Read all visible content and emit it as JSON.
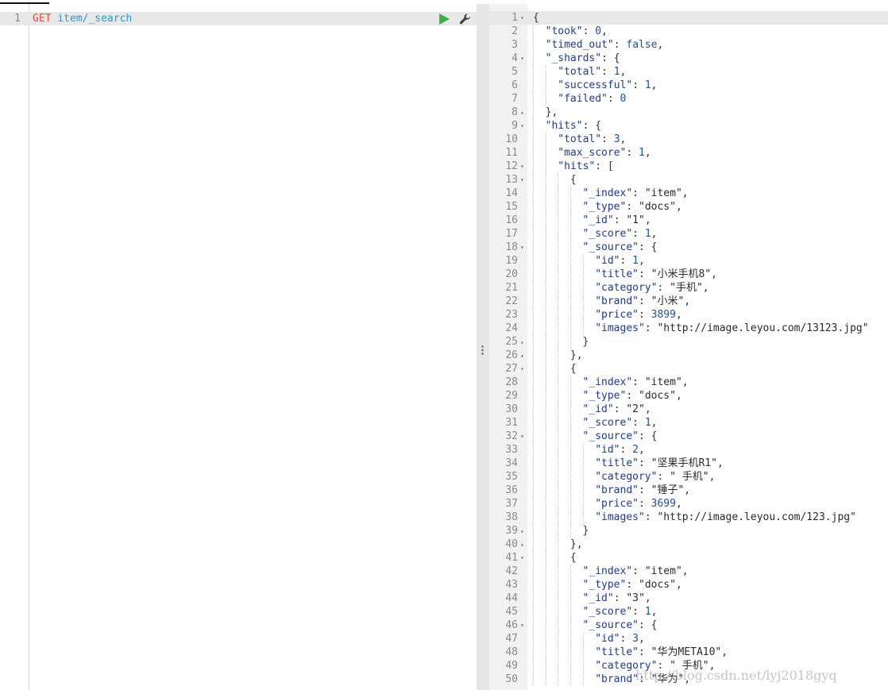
{
  "request": {
    "line_number": "1",
    "method": "GET",
    "path": "item/_search",
    "run_icon": "play-icon",
    "settings_icon": "wrench-icon"
  },
  "response": {
    "lines": [
      {
        "n": "1",
        "fold": "▾",
        "indent": 0,
        "t": [
          [
            "p",
            "{"
          ]
        ]
      },
      {
        "n": "2",
        "indent": 1,
        "t": [
          [
            "k",
            "\"took\""
          ],
          [
            "p",
            ": "
          ],
          [
            "n",
            "0"
          ],
          [
            "p",
            ","
          ]
        ]
      },
      {
        "n": "3",
        "indent": 1,
        "t": [
          [
            "k",
            "\"timed_out\""
          ],
          [
            "p",
            ": "
          ],
          [
            "b",
            "false"
          ],
          [
            "p",
            ","
          ]
        ]
      },
      {
        "n": "4",
        "fold": "▾",
        "indent": 1,
        "t": [
          [
            "k",
            "\"_shards\""
          ],
          [
            "p",
            ": {"
          ]
        ]
      },
      {
        "n": "5",
        "indent": 2,
        "t": [
          [
            "k",
            "\"total\""
          ],
          [
            "p",
            ": "
          ],
          [
            "n",
            "1"
          ],
          [
            "p",
            ","
          ]
        ]
      },
      {
        "n": "6",
        "indent": 2,
        "t": [
          [
            "k",
            "\"successful\""
          ],
          [
            "p",
            ": "
          ],
          [
            "n",
            "1"
          ],
          [
            "p",
            ","
          ]
        ]
      },
      {
        "n": "7",
        "indent": 2,
        "t": [
          [
            "k",
            "\"failed\""
          ],
          [
            "p",
            ": "
          ],
          [
            "n",
            "0"
          ]
        ]
      },
      {
        "n": "8",
        "fold": "▴",
        "indent": 1,
        "t": [
          [
            "p",
            "},"
          ]
        ]
      },
      {
        "n": "9",
        "fold": "▾",
        "indent": 1,
        "t": [
          [
            "k",
            "\"hits\""
          ],
          [
            "p",
            ": {"
          ]
        ]
      },
      {
        "n": "10",
        "indent": 2,
        "t": [
          [
            "k",
            "\"total\""
          ],
          [
            "p",
            ": "
          ],
          [
            "n",
            "3"
          ],
          [
            "p",
            ","
          ]
        ]
      },
      {
        "n": "11",
        "indent": 2,
        "t": [
          [
            "k",
            "\"max_score\""
          ],
          [
            "p",
            ": "
          ],
          [
            "n",
            "1"
          ],
          [
            "p",
            ","
          ]
        ]
      },
      {
        "n": "12",
        "fold": "▾",
        "indent": 2,
        "t": [
          [
            "k",
            "\"hits\""
          ],
          [
            "p",
            ": ["
          ]
        ]
      },
      {
        "n": "13",
        "fold": "▾",
        "indent": 3,
        "t": [
          [
            "p",
            "{"
          ]
        ]
      },
      {
        "n": "14",
        "indent": 4,
        "t": [
          [
            "k",
            "\"_index\""
          ],
          [
            "p",
            ": "
          ],
          [
            "s",
            "\"item\""
          ],
          [
            "p",
            ","
          ]
        ]
      },
      {
        "n": "15",
        "indent": 4,
        "t": [
          [
            "k",
            "\"_type\""
          ],
          [
            "p",
            ": "
          ],
          [
            "s",
            "\"docs\""
          ],
          [
            "p",
            ","
          ]
        ]
      },
      {
        "n": "16",
        "indent": 4,
        "t": [
          [
            "k",
            "\"_id\""
          ],
          [
            "p",
            ": "
          ],
          [
            "s",
            "\"1\""
          ],
          [
            "p",
            ","
          ]
        ]
      },
      {
        "n": "17",
        "indent": 4,
        "t": [
          [
            "k",
            "\"_score\""
          ],
          [
            "p",
            ": "
          ],
          [
            "n",
            "1"
          ],
          [
            "p",
            ","
          ]
        ]
      },
      {
        "n": "18",
        "fold": "▾",
        "indent": 4,
        "t": [
          [
            "k",
            "\"_source\""
          ],
          [
            "p",
            ": {"
          ]
        ]
      },
      {
        "n": "19",
        "indent": 5,
        "t": [
          [
            "k",
            "\"id\""
          ],
          [
            "p",
            ": "
          ],
          [
            "n",
            "1"
          ],
          [
            "p",
            ","
          ]
        ]
      },
      {
        "n": "20",
        "indent": 5,
        "t": [
          [
            "k",
            "\"title\""
          ],
          [
            "p",
            ": "
          ],
          [
            "s",
            "\"小米手机8\""
          ],
          [
            "p",
            ","
          ]
        ]
      },
      {
        "n": "21",
        "indent": 5,
        "t": [
          [
            "k",
            "\"category\""
          ],
          [
            "p",
            ": "
          ],
          [
            "s",
            "\"手机\""
          ],
          [
            "p",
            ","
          ]
        ]
      },
      {
        "n": "22",
        "indent": 5,
        "t": [
          [
            "k",
            "\"brand\""
          ],
          [
            "p",
            ": "
          ],
          [
            "s",
            "\"小米\""
          ],
          [
            "p",
            ","
          ]
        ]
      },
      {
        "n": "23",
        "indent": 5,
        "t": [
          [
            "k",
            "\"price\""
          ],
          [
            "p",
            ": "
          ],
          [
            "n",
            "3899"
          ],
          [
            "p",
            ","
          ]
        ]
      },
      {
        "n": "24",
        "indent": 5,
        "t": [
          [
            "k",
            "\"images\""
          ],
          [
            "p",
            ": "
          ],
          [
            "s",
            "\"http://image.leyou.com/13123.jpg\""
          ]
        ]
      },
      {
        "n": "25",
        "fold": "▴",
        "indent": 4,
        "t": [
          [
            "p",
            "}"
          ]
        ]
      },
      {
        "n": "26",
        "fold": "▴",
        "indent": 3,
        "t": [
          [
            "p",
            "},"
          ]
        ]
      },
      {
        "n": "27",
        "fold": "▾",
        "indent": 3,
        "t": [
          [
            "p",
            "{"
          ]
        ]
      },
      {
        "n": "28",
        "indent": 4,
        "t": [
          [
            "k",
            "\"_index\""
          ],
          [
            "p",
            ": "
          ],
          [
            "s",
            "\"item\""
          ],
          [
            "p",
            ","
          ]
        ]
      },
      {
        "n": "29",
        "indent": 4,
        "t": [
          [
            "k",
            "\"_type\""
          ],
          [
            "p",
            ": "
          ],
          [
            "s",
            "\"docs\""
          ],
          [
            "p",
            ","
          ]
        ]
      },
      {
        "n": "30",
        "indent": 4,
        "t": [
          [
            "k",
            "\"_id\""
          ],
          [
            "p",
            ": "
          ],
          [
            "s",
            "\"2\""
          ],
          [
            "p",
            ","
          ]
        ]
      },
      {
        "n": "31",
        "indent": 4,
        "t": [
          [
            "k",
            "\"_score\""
          ],
          [
            "p",
            ": "
          ],
          [
            "n",
            "1"
          ],
          [
            "p",
            ","
          ]
        ]
      },
      {
        "n": "32",
        "fold": "▾",
        "indent": 4,
        "t": [
          [
            "k",
            "\"_source\""
          ],
          [
            "p",
            ": {"
          ]
        ]
      },
      {
        "n": "33",
        "indent": 5,
        "t": [
          [
            "k",
            "\"id\""
          ],
          [
            "p",
            ": "
          ],
          [
            "n",
            "2"
          ],
          [
            "p",
            ","
          ]
        ]
      },
      {
        "n": "34",
        "indent": 5,
        "t": [
          [
            "k",
            "\"title\""
          ],
          [
            "p",
            ": "
          ],
          [
            "s",
            "\"坚果手机R1\""
          ],
          [
            "p",
            ","
          ]
        ]
      },
      {
        "n": "35",
        "indent": 5,
        "t": [
          [
            "k",
            "\"category\""
          ],
          [
            "p",
            ": "
          ],
          [
            "s",
            "\" 手机\""
          ],
          [
            "p",
            ","
          ]
        ]
      },
      {
        "n": "36",
        "indent": 5,
        "t": [
          [
            "k",
            "\"brand\""
          ],
          [
            "p",
            ": "
          ],
          [
            "s",
            "\"锤子\""
          ],
          [
            "p",
            ","
          ]
        ]
      },
      {
        "n": "37",
        "indent": 5,
        "t": [
          [
            "k",
            "\"price\""
          ],
          [
            "p",
            ": "
          ],
          [
            "n",
            "3699"
          ],
          [
            "p",
            ","
          ]
        ]
      },
      {
        "n": "38",
        "indent": 5,
        "t": [
          [
            "k",
            "\"images\""
          ],
          [
            "p",
            ": "
          ],
          [
            "s",
            "\"http://image.leyou.com/123.jpg\""
          ]
        ]
      },
      {
        "n": "39",
        "fold": "▴",
        "indent": 4,
        "t": [
          [
            "p",
            "}"
          ]
        ]
      },
      {
        "n": "40",
        "fold": "▴",
        "indent": 3,
        "t": [
          [
            "p",
            "},"
          ]
        ]
      },
      {
        "n": "41",
        "fold": "▾",
        "indent": 3,
        "t": [
          [
            "p",
            "{"
          ]
        ]
      },
      {
        "n": "42",
        "indent": 4,
        "t": [
          [
            "k",
            "\"_index\""
          ],
          [
            "p",
            ": "
          ],
          [
            "s",
            "\"item\""
          ],
          [
            "p",
            ","
          ]
        ]
      },
      {
        "n": "43",
        "indent": 4,
        "t": [
          [
            "k",
            "\"_type\""
          ],
          [
            "p",
            ": "
          ],
          [
            "s",
            "\"docs\""
          ],
          [
            "p",
            ","
          ]
        ]
      },
      {
        "n": "44",
        "indent": 4,
        "t": [
          [
            "k",
            "\"_id\""
          ],
          [
            "p",
            ": "
          ],
          [
            "s",
            "\"3\""
          ],
          [
            "p",
            ","
          ]
        ]
      },
      {
        "n": "45",
        "indent": 4,
        "t": [
          [
            "k",
            "\"_score\""
          ],
          [
            "p",
            ": "
          ],
          [
            "n",
            "1"
          ],
          [
            "p",
            ","
          ]
        ]
      },
      {
        "n": "46",
        "fold": "▾",
        "indent": 4,
        "t": [
          [
            "k",
            "\"_source\""
          ],
          [
            "p",
            ": {"
          ]
        ]
      },
      {
        "n": "47",
        "indent": 5,
        "t": [
          [
            "k",
            "\"id\""
          ],
          [
            "p",
            ": "
          ],
          [
            "n",
            "3"
          ],
          [
            "p",
            ","
          ]
        ]
      },
      {
        "n": "48",
        "indent": 5,
        "t": [
          [
            "k",
            "\"title\""
          ],
          [
            "p",
            ": "
          ],
          [
            "s",
            "\"华为META10\""
          ],
          [
            "p",
            ","
          ]
        ]
      },
      {
        "n": "49",
        "indent": 5,
        "t": [
          [
            "k",
            "\"category\""
          ],
          [
            "p",
            ": "
          ],
          [
            "s",
            "\" 手机\""
          ],
          [
            "p",
            ","
          ]
        ]
      },
      {
        "n": "50",
        "indent": 5,
        "t": [
          [
            "k",
            "\"brand\""
          ],
          [
            "p",
            ": "
          ],
          [
            "s",
            "\"华为\""
          ],
          [
            "p",
            ","
          ]
        ]
      }
    ]
  },
  "watermark": "http://blog.csdn.net/lyj2018gyq",
  "colors": {
    "method": "#e74c3c",
    "path": "#3399cc",
    "key": "#1f3a93",
    "number": "#1e50a2",
    "run_button": "#3cb043"
  }
}
